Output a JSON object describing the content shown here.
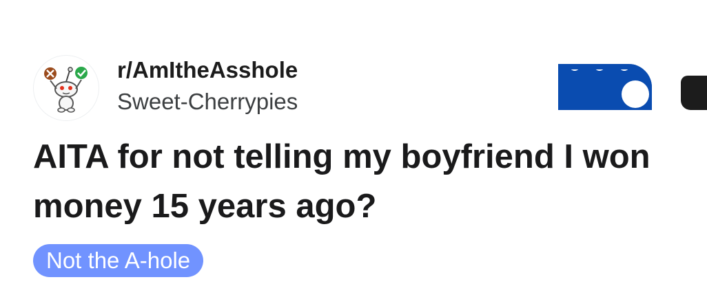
{
  "post": {
    "subreddit": "r/AmItheAsshole",
    "author": "Sweet-Cherrypies",
    "title": "AITA for not telling my boyfriend I won money 15 years ago?",
    "flair": "Not the A-hole"
  },
  "icons": {
    "avatar": "subreddit-snoo-avatar",
    "join": "join-button",
    "more": "overflow-menu-icon"
  },
  "colors": {
    "flair_background": "#7193ff",
    "join_button": "#0a4cb0",
    "title_text": "#1a1a1b"
  }
}
